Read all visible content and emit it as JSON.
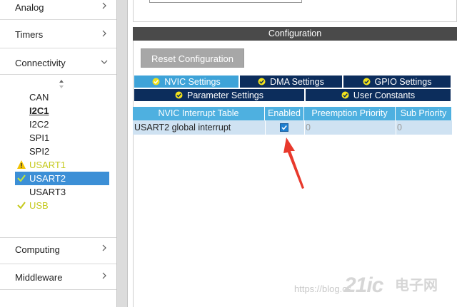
{
  "categories": [
    {
      "label": "Analog",
      "expanded": false
    },
    {
      "label": "Timers",
      "expanded": false
    },
    {
      "label": "Connectivity",
      "expanded": true
    },
    {
      "label": "Computing",
      "expanded": false
    },
    {
      "label": "Middleware",
      "expanded": false
    }
  ],
  "peripherals": [
    {
      "label": "CAN",
      "status": "none"
    },
    {
      "label": "I2C1",
      "status": "bold"
    },
    {
      "label": "I2C2",
      "status": "none"
    },
    {
      "label": "SPI1",
      "status": "none"
    },
    {
      "label": "SPI2",
      "status": "none"
    },
    {
      "label": "USART1",
      "status": "warning"
    },
    {
      "label": "USART2",
      "status": "selected"
    },
    {
      "label": "USART3",
      "status": "none"
    },
    {
      "label": "USB",
      "status": "ok"
    }
  ],
  "config": {
    "header": "Configuration",
    "reset_label": "Reset Configuration"
  },
  "tabs": [
    {
      "label": "NVIC Settings",
      "active": true
    },
    {
      "label": "DMA Settings",
      "active": false
    },
    {
      "label": "GPIO Settings",
      "active": false
    },
    {
      "label": "Parameter Settings",
      "active": false
    },
    {
      "label": "User Constants",
      "active": false
    }
  ],
  "nvic_table": {
    "columns": [
      "NVIC Interrupt Table",
      "Enabled",
      "Preemption Priority",
      "Sub Priority"
    ],
    "rows": [
      {
        "name": "USART2 global interrupt",
        "enabled": true,
        "preemption": "0",
        "sub": "0"
      }
    ]
  },
  "watermark": {
    "url": "https://blog.cs",
    "logo": "21ic",
    "cn_top": "电子网",
    "cn_bottom": "网"
  },
  "colors": {
    "selected": "#3c8fd6",
    "ok": "#c5c91c",
    "tab_active": "#3ea3d8",
    "tab_inactive": "#0c2d5c",
    "table_header": "#4eb0e0",
    "arrow": "#e8392c"
  }
}
